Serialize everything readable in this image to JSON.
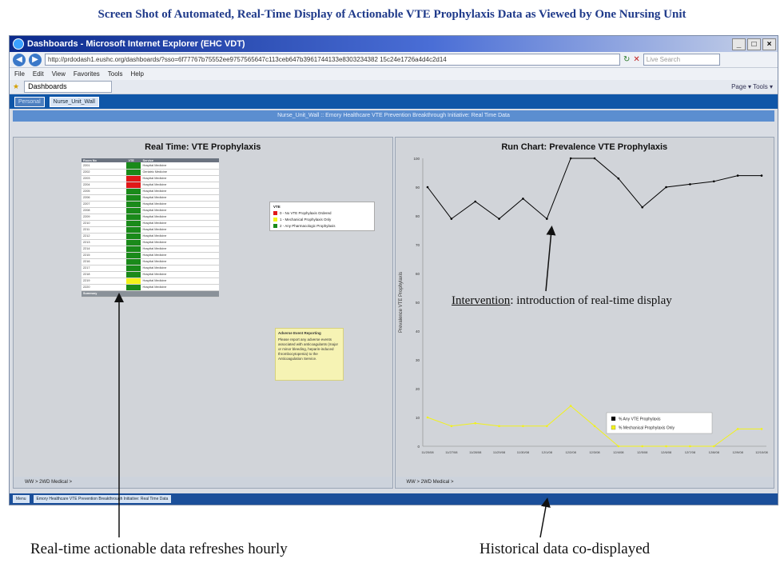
{
  "caption": "Screen Shot of Automated, Real-Time Display of Actionable VTE Prophylaxis Data as Viewed by One Nursing Unit",
  "browser": {
    "title": "Dashboards - Microsoft Internet Explorer (EHC VDT)",
    "url": "http://prdodash1.eushc.org/dashboards/?sso=6f77767b75552ee9757565647c113ceb647b3961744133e8303234382 15c24e1726a4d4c2d14",
    "search_placeholder": "Live Search",
    "menu": [
      "File",
      "Edit",
      "View",
      "Favorites",
      "Tools",
      "Help"
    ],
    "tab_label": "Dashboards",
    "tools_text": "Page ▾  Tools ▾"
  },
  "app": {
    "toolbar_buttons": [
      "Personal",
      "Nurse_Unit_Wall"
    ],
    "panel_title": "Nurse_Unit_Wall :: Emory Healthcare VTE Prevention Breakthrough Initiative: Real Time Data"
  },
  "left_pane": {
    "title": "Real Time: VTE Prophylaxis",
    "table": {
      "headers": [
        "Room No",
        "VTE",
        "Service"
      ],
      "rows": [
        {
          "room": "2201",
          "vte": "2",
          "service": "Hospital Medicine"
        },
        {
          "room": "2202",
          "vte": "2",
          "service": "Geriatric Medicine"
        },
        {
          "room": "2203",
          "vte": "0",
          "service": "Hospital Medicine"
        },
        {
          "room": "2204",
          "vte": "0",
          "service": "Hospital Medicine"
        },
        {
          "room": "2205",
          "vte": "2",
          "service": "Hospital Medicine"
        },
        {
          "room": "2206",
          "vte": "2",
          "service": "Hospital Medicine"
        },
        {
          "room": "2207",
          "vte": "2",
          "service": "Hospital Medicine"
        },
        {
          "room": "2208",
          "vte": "2",
          "service": "Hospital Medicine"
        },
        {
          "room": "2209",
          "vte": "2",
          "service": "Hospital Medicine"
        },
        {
          "room": "2210",
          "vte": "2",
          "service": "Hospital Medicine"
        },
        {
          "room": "2211",
          "vte": "2",
          "service": "Hospital Medicine"
        },
        {
          "room": "2212",
          "vte": "2",
          "service": "Hospital Medicine"
        },
        {
          "room": "2213",
          "vte": "2",
          "service": "Hospital Medicine"
        },
        {
          "room": "2214",
          "vte": "2",
          "service": "Hospital Medicine"
        },
        {
          "room": "2215",
          "vte": "2",
          "service": "Hospital Medicine"
        },
        {
          "room": "2216",
          "vte": "2",
          "service": "Hospital Medicine"
        },
        {
          "room": "2217",
          "vte": "2",
          "service": "Hospital Medicine"
        },
        {
          "room": "2218",
          "vte": "2",
          "service": "Hospital Medicine"
        },
        {
          "room": "2219",
          "vte": "1",
          "service": "Hospital Medicine"
        },
        {
          "room": "2220",
          "vte": "2",
          "service": "Hospital Medicine"
        }
      ],
      "summary_label": "Summary"
    },
    "legend": {
      "title": "VTE",
      "items": [
        {
          "label": "0 - No VTE Prophylaxis Ordered",
          "color": "#e01818"
        },
        {
          "label": "1 - Mechanical Prophylaxis Only",
          "color": "#f2f21a"
        },
        {
          "label": "2 - Any Pharmacologic Prophylaxis",
          "color": "#1a8a1a"
        }
      ]
    },
    "adverse": {
      "title": "Adverse Event Reporting",
      "body": "Please report any adverse events associated with anticoagulants (major or minor bleeding, heparin-induced thrombocytopenia) to the Anticoagulation Service."
    },
    "footer": "WW  >  2WD Medical  >"
  },
  "right_pane": {
    "title": "Run Chart: Prevalence VTE Prophylaxis",
    "footer": "WW  >  2WD Medical  >"
  },
  "taskbar": [
    "Menu",
    "Emory Healthcare VTE Prevention Breakthrough Initiative: Real Time Data"
  ],
  "annotations": {
    "intervention_word": "Intervention",
    "intervention_rest": ": introduction of real-time display",
    "left_note": "Real-time actionable data refreshes hourly",
    "right_note": "Historical data co-displayed"
  },
  "chart_data": {
    "type": "line",
    "title": "Run Chart: Prevalence VTE Prophylaxis",
    "ylabel": "Prevalence VTE Prophylaxis",
    "xlabel": "",
    "ylim": [
      0,
      100
    ],
    "yticks": [
      0,
      10,
      20,
      30,
      40,
      50,
      60,
      70,
      80,
      90,
      100
    ],
    "categories": [
      "11/20/08",
      "11/27/08",
      "11/28/08",
      "11/29/08",
      "11/30/08",
      "12/1/08",
      "12/2/08",
      "12/3/08",
      "12/4/08",
      "12/5/08",
      "12/6/08",
      "12/7/08",
      "12/8/08",
      "12/9/08",
      "12/10/08"
    ],
    "series": [
      {
        "name": "% Any VTE Prophylaxis",
        "color": "#000000",
        "values": [
          90,
          79,
          85,
          79,
          86,
          79,
          100,
          100,
          93,
          83,
          90,
          91,
          92,
          94,
          94
        ]
      },
      {
        "name": "% Mechanical Prophylaxis Only",
        "color": "#f2f21a",
        "values": [
          10,
          7,
          8,
          7,
          7,
          7,
          14,
          7,
          0,
          0,
          0,
          0,
          0,
          6,
          6
        ]
      }
    ],
    "legend_position": "bottom-right"
  }
}
